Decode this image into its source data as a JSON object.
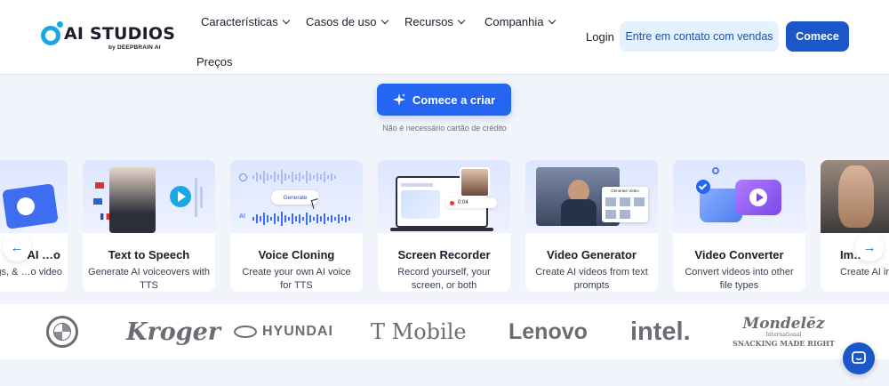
{
  "header": {
    "logo_text": "AI STUDIOS",
    "logo_sub": "by DEEPBRAIN AI",
    "nav": [
      "Características",
      "Casos de uso",
      "Recursos",
      "Companhia"
    ],
    "nav_second": "Preços",
    "login": "Login",
    "sales_button": "Entre em contato com vendas",
    "start_button": "Comece"
  },
  "hero": {
    "cta": "Comece a criar",
    "note": "Não é necessário cartão de crédito"
  },
  "cards": [
    {
      "title": "AI …o",
      "desc": "…cles, blogs, & …o video"
    },
    {
      "title": "Text to Speech",
      "desc": "Generate AI voiceovers with TTS"
    },
    {
      "title": "Voice Cloning",
      "desc": "Create your own AI voice for TTS"
    },
    {
      "title": "Screen Recorder",
      "desc": "Record yourself, your screen, or both"
    },
    {
      "title": "Video Generator",
      "desc": "Create AI videos from text prompts"
    },
    {
      "title": "Video Converter",
      "desc": "Convert videos into other file types"
    },
    {
      "title": "Im…",
      "desc": "Create AI im… text pr…"
    }
  ],
  "card_media": {
    "voice_generate": "Generate",
    "voice_ai": "AI",
    "recorder_time": "0:04",
    "generator_label": "Generate Video"
  },
  "brands": {
    "kroger": "Kroger",
    "hyundai": "HYUNDAI",
    "tmobile": "T Mobile",
    "lenovo": "Lenovo",
    "intel": "intel.",
    "mondelez": "Mondelēz",
    "mondelez_sub": "International",
    "mondelez_tag": "SNACKING MADE RIGHT"
  },
  "colors": {
    "primary": "#2465f2",
    "primary_dark": "#1a57c8",
    "sales_bg": "#e4f1ff",
    "logo_accent": "#19a7e6",
    "page_bg": "#f2f4fb"
  }
}
